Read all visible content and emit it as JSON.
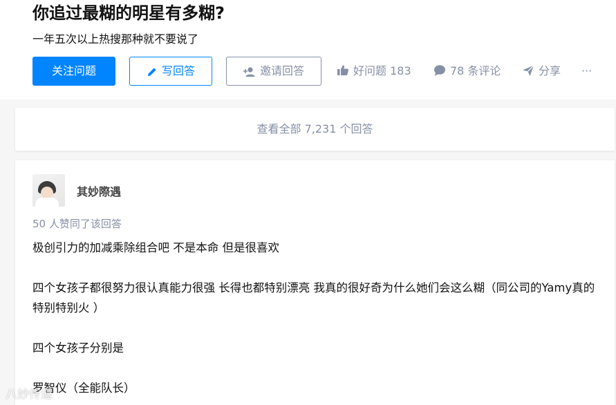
{
  "question": {
    "title": "你追过最糊的明星有多糊?",
    "description": "一年五次以上热搜那种就不要说了"
  },
  "actions": {
    "follow_label": "关注问题",
    "write_label": "写回答",
    "invite_label": "邀请回答",
    "good_question_label": "好问题 183",
    "comments_label": "78 条评论",
    "share_label": "分享",
    "more_label": "···"
  },
  "view_all_label": "查看全部 7,231 个回答",
  "answer": {
    "author": "其妙際遇",
    "votes_text": "50 人赞同了该回答",
    "paragraphs": [
      "极创引力的加减乘除组合吧 不是本命 但是很喜欢",
      "",
      "四个女孩子都很努力很认真能力很强 长得也都特别漂亮 我真的很好奇为什么她们会这么糊（同公司的Yamy真的特别特别火 ）",
      "",
      "四个女孩子分别是",
      "",
      "罗智仪（全能队长）"
    ]
  },
  "watermark_text": "八妙传道",
  "colors": {
    "primary": "#0084ff",
    "secondary_text": "#8590a6",
    "background": "#f6f6f6"
  }
}
